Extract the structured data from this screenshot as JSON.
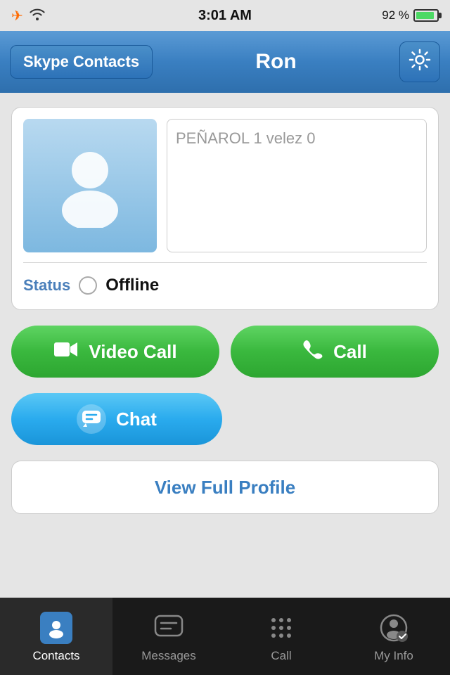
{
  "statusBar": {
    "time": "3:01 AM",
    "batteryPct": "92 %"
  },
  "header": {
    "backLabel": "Skype Contacts",
    "title": "Ron",
    "settingsAriaLabel": "Settings"
  },
  "profile": {
    "moodText": "PEÑAROL 1 velez 0",
    "statusLabel": "Status",
    "statusValue": "Offline"
  },
  "buttons": {
    "videoCall": "Video Call",
    "call": "Call",
    "chat": "Chat",
    "viewFullProfile": "View Full Profile"
  },
  "tabBar": {
    "tabs": [
      {
        "id": "contacts",
        "label": "Contacts",
        "active": true
      },
      {
        "id": "messages",
        "label": "Messages",
        "active": false
      },
      {
        "id": "call",
        "label": "Call",
        "active": false
      },
      {
        "id": "myinfo",
        "label": "My Info",
        "active": false
      }
    ]
  }
}
